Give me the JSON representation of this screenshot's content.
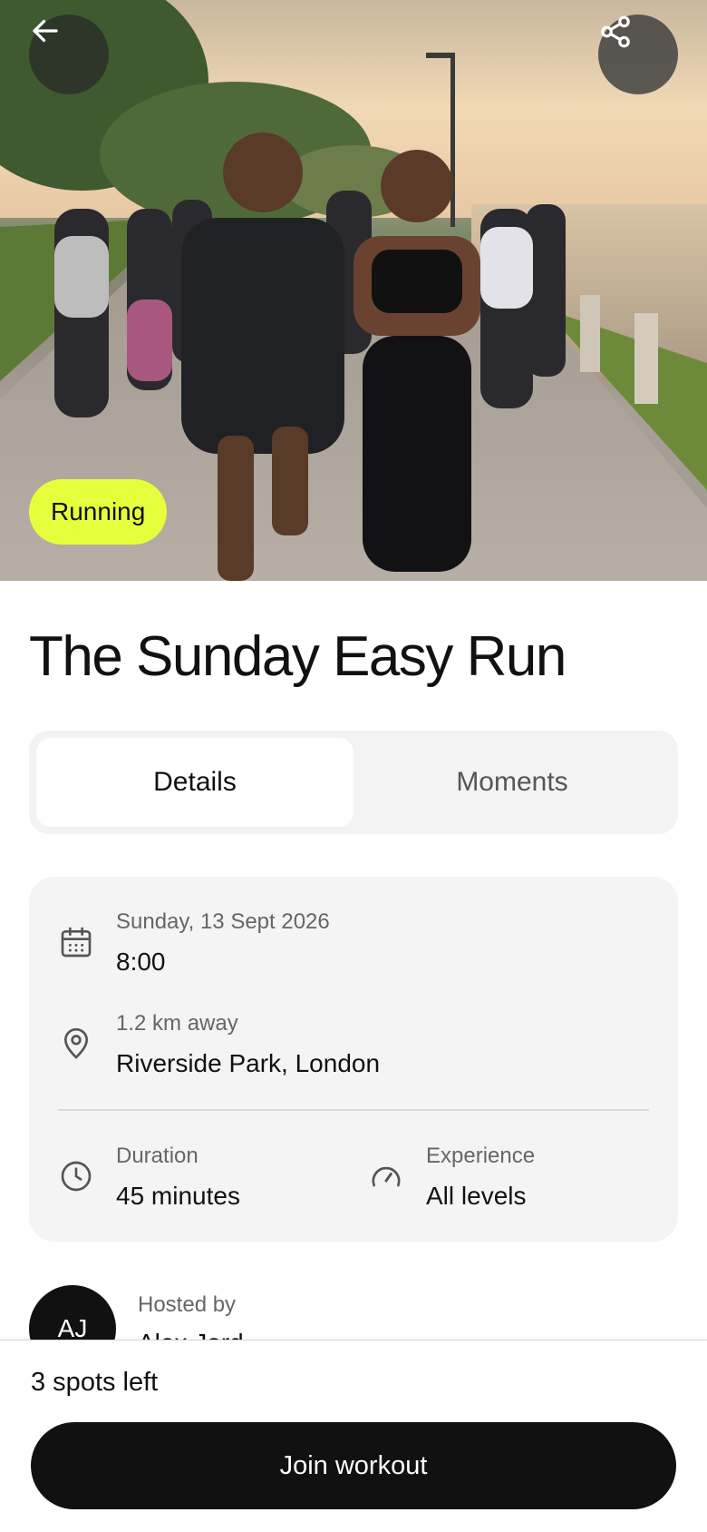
{
  "hero": {
    "category_badge": "Running",
    "icons": {
      "back": "arrow-left-icon",
      "share": "share-icon"
    }
  },
  "event": {
    "title": "The Sunday Easy Run"
  },
  "tabs": [
    {
      "label": "Details",
      "active": true
    },
    {
      "label": "Moments",
      "active": false
    }
  ],
  "details": {
    "date": "Sunday, 13 Sept 2026",
    "time": "8:00",
    "distance": "1.2 km away",
    "location": "Riverside Park, London",
    "duration_label": "Duration",
    "duration_value": "45 minutes",
    "experience_label": "Experience",
    "experience_value": "All levels"
  },
  "host": {
    "label": "Hosted by",
    "initials": "AJ",
    "name": "Alex Jord"
  },
  "footer": {
    "spots": "3 spots left",
    "cta": "Join workout"
  },
  "colors": {
    "accent": "#e6ff3c",
    "primary_button": "#111111",
    "card_background": "#f4f4f4"
  }
}
